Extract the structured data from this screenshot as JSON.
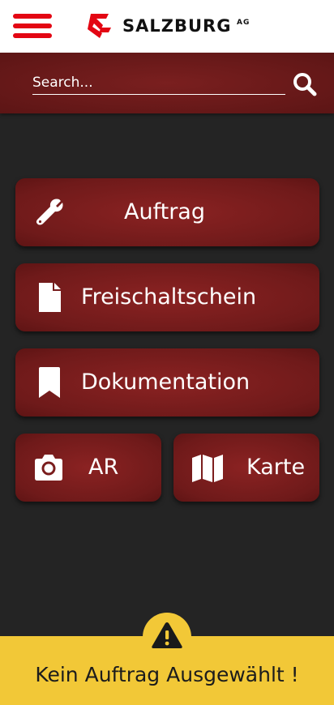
{
  "header": {
    "logo_text": "SALZBURG",
    "logo_suffix": "AG",
    "menu_icon": "hamburger-icon",
    "brand_color": "#e30613"
  },
  "search": {
    "placeholder": "Search...",
    "icon": "search-icon"
  },
  "tiles": [
    {
      "label": "Auftrag",
      "icon": "wrench-icon"
    },
    {
      "label": "Freischaltschein",
      "icon": "file-icon"
    },
    {
      "label": "Dokumentation",
      "icon": "bookmark-icon"
    },
    {
      "label": "AR",
      "icon": "camera-icon"
    },
    {
      "label": "Karte",
      "icon": "map-icon"
    }
  ],
  "footer": {
    "message": "Kein Auftrag Ausgewählt !",
    "icon": "warning-icon",
    "color": "#f2c837"
  },
  "colors": {
    "tile_red": "#7a1d1d",
    "background": "#242424"
  }
}
